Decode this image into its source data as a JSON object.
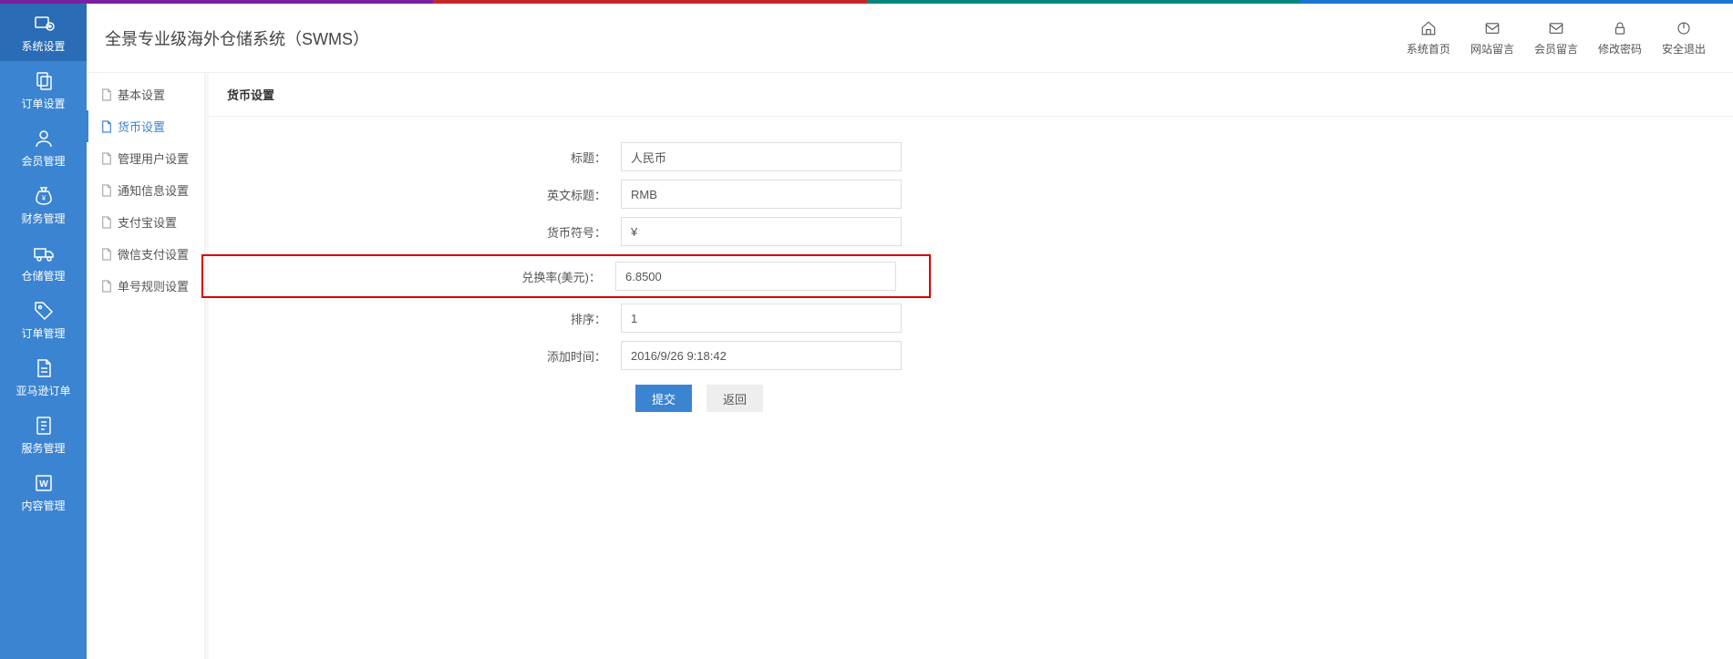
{
  "app_title": "全景专业级海外仓储系统（SWMS）",
  "header_actions": [
    {
      "label": "系统首页"
    },
    {
      "label": "网站留言"
    },
    {
      "label": "会员留言"
    },
    {
      "label": "修改密码"
    },
    {
      "label": "安全退出"
    }
  ],
  "sidebar_main": [
    {
      "label": "系统设置"
    },
    {
      "label": "订单设置"
    },
    {
      "label": "会员管理"
    },
    {
      "label": "财务管理"
    },
    {
      "label": "仓储管理"
    },
    {
      "label": "订单管理"
    },
    {
      "label": "亚马逊订单"
    },
    {
      "label": "服务管理"
    },
    {
      "label": "内容管理"
    }
  ],
  "sidebar_sub": [
    {
      "label": "基本设置"
    },
    {
      "label": "货币设置"
    },
    {
      "label": "管理用户设置"
    },
    {
      "label": "通知信息设置"
    },
    {
      "label": "支付宝设置"
    },
    {
      "label": "微信支付设置"
    },
    {
      "label": "单号规则设置"
    }
  ],
  "panel_title": "货币设置",
  "form": {
    "title_label": "标题：",
    "title_value": "人民币",
    "en_title_label": "英文标题：",
    "en_title_value": "RMB",
    "symbol_label": "货币符号：",
    "symbol_value": "¥",
    "rate_label": "兑换率(美元)：",
    "rate_value": "6.8500",
    "sort_label": "排序：",
    "sort_value": "1",
    "addtime_label": "添加时间：",
    "addtime_value": "2016/9/26 9:18:42"
  },
  "buttons": {
    "submit": "提交",
    "back": "返回"
  }
}
